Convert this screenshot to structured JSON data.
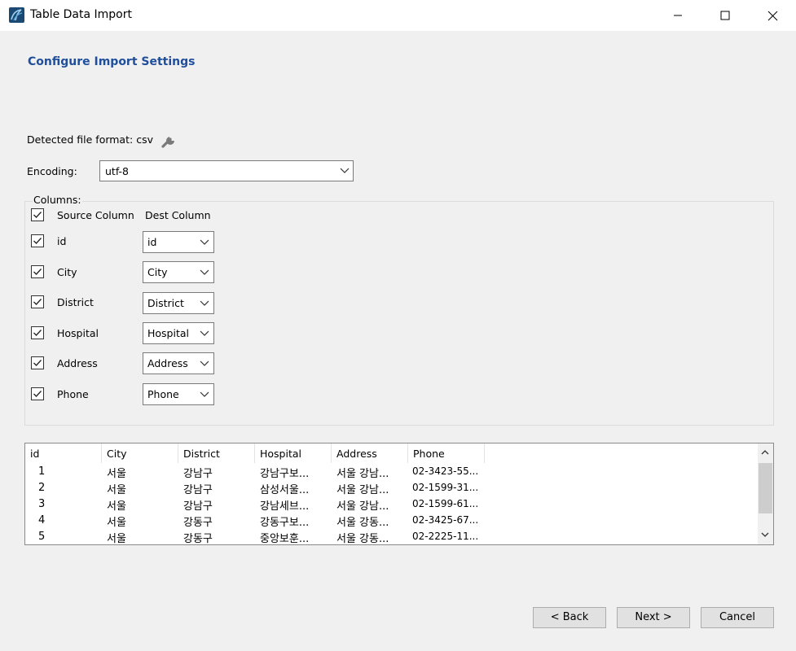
{
  "window": {
    "title": "Table Data Import",
    "icon": "mysql-workbench-icon"
  },
  "page": {
    "heading": "Configure Import Settings"
  },
  "format": {
    "label": "Detected file format:",
    "value": "csv",
    "icon": "wrench-icon"
  },
  "encoding": {
    "label": "Encoding:",
    "value": "utf-8"
  },
  "columns": {
    "legend": "Columns:",
    "header_source": "Source Column",
    "header_dest": "Dest Column",
    "header_checked": true,
    "rows": [
      {
        "source": "id",
        "dest": "id",
        "checked": true
      },
      {
        "source": "City",
        "dest": "City",
        "checked": true
      },
      {
        "source": "District",
        "dest": "District",
        "checked": true
      },
      {
        "source": "Hospital",
        "dest": "Hospital",
        "checked": true
      },
      {
        "source": "Address",
        "dest": "Address",
        "checked": true
      },
      {
        "source": "Phone",
        "dest": "Phone",
        "checked": true
      }
    ]
  },
  "preview": {
    "headers": [
      "id",
      "City",
      "District",
      "Hospital",
      "Address",
      "Phone"
    ],
    "rows": [
      [
        "1",
        "서울",
        "강남구",
        "강남구보...",
        "서울 강남...",
        "02-3423-55..."
      ],
      [
        "2",
        "서울",
        "강남구",
        "삼성서울...",
        "서울 강남...",
        "02-1599-31..."
      ],
      [
        "3",
        "서울",
        "강남구",
        "강남세브...",
        "서울 강남...",
        "02-1599-61..."
      ],
      [
        "4",
        "서울",
        "강동구",
        "강동구보...",
        "서울 강동...",
        "02-3425-67..."
      ],
      [
        "5",
        "서울",
        "강동구",
        "중앙보훈...",
        "서울 강동...",
        "02-2225-11..."
      ]
    ]
  },
  "buttons": {
    "back": "< Back",
    "next": "Next >",
    "cancel": "Cancel"
  }
}
